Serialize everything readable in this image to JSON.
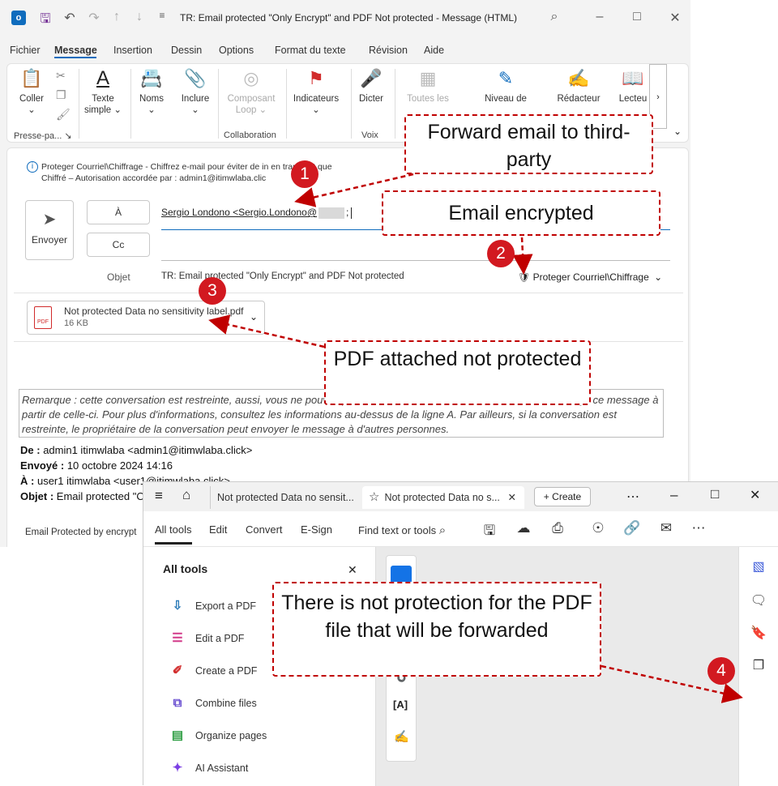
{
  "outlook": {
    "title": "TR: Email protected \"Only Encrypt\" and PDF Not protected  -  Message (HTML)",
    "menu": [
      "Fichier",
      "Message",
      "Insertion",
      "Dessin",
      "Options",
      "Format du texte",
      "Révision",
      "Aide"
    ],
    "ribbon": {
      "coller": "Coller",
      "texte": "Texte",
      "simple": "simple ⌄",
      "noms": "Noms",
      "inclure": "Inclure",
      "composant": "Composant",
      "loop": "Loop ⌄",
      "indicateurs": "Indicateurs",
      "dicter": "Dicter",
      "toutes": "Toutes les",
      "niveau": "Niveau de",
      "redacteur": "Rédacteur",
      "lecteur": "Lecteu",
      "grp_presse": "Presse-pa...",
      "grp_collab": "Collaboration",
      "grp_voix": "Voix"
    },
    "banner_line1": "Proteger Courriel\\Chiffrage - Chiffrez e-mail pour éviter de in",
    "banner_line1b": "en transit et que",
    "banner_line2": "Chiffré – Autorisation accordée par : admin1@itimwlaba.clic",
    "send_label": "Envoyer",
    "to_label": "À",
    "cc_label": "Cc",
    "to_value": "Sergio Londono <Sergio.Londono@",
    "to_suffix": ";",
    "subject_label": "Objet",
    "subject_value": "TR: Email protected \"Only Encrypt\" and PDF Not protected",
    "sensitivity_label": "Proteger Courriel\\Chiffrage",
    "attachment_name": "Not protected Data no sensitivity label.pdf",
    "attachment_size": "16 KB",
    "attachment_icon": "PDF",
    "note_text": "Remarque : cette conversation est restreinte, aussi, vous ne pouvez pas la transférer sans autorisation. Si vous avez reçu ce message à partir de celle-ci. Pour plus d'informations, consultez les informations au-dessus de la ligne A. Par ailleurs, si la conversation est restreinte, le propriétaire de la conversation peut envoyer le message à d'autres personnes.",
    "from_label": "De :",
    "from_value": "admin1 itimwlaba <admin1@itimwlaba.click>",
    "sent_label": "Envoyé :",
    "sent_value": "10 octobre 2024 14:16",
    "to2_label": "À :",
    "to2_value": "user1 itimwlaba <user1@itimwlaba.click>",
    "subj2_label": "Objet :",
    "subj2_value": "Email protected \"O",
    "body_text": "Email Protected by encrypt"
  },
  "acrobat": {
    "tab1": "Not protected Data no sensit...",
    "tab2": "Not protected Data no s...",
    "create": "Create",
    "toolbar": [
      "All tools",
      "Edit",
      "Convert",
      "E-Sign"
    ],
    "find": "Find text or tools",
    "panel_title": "All tools",
    "tools": [
      {
        "label": "Export a PDF",
        "icon": "export-pdf-icon",
        "color": "#2a7ab8"
      },
      {
        "label": "Edit a PDF",
        "icon": "edit-pdf-icon",
        "color": "#d23b8a"
      },
      {
        "label": "Create a PDF",
        "icon": "create-pdf-icon",
        "color": "#d22d2d"
      },
      {
        "label": "Combine files",
        "icon": "combine-files-icon",
        "color": "#6a4fd0"
      },
      {
        "label": "Organize pages",
        "icon": "organize-pages-icon",
        "color": "#2f9e44"
      },
      {
        "label": "AI Assistant",
        "icon": "ai-assistant-icon",
        "color": "#7b3fe4"
      }
    ]
  },
  "callouts": {
    "c1": "Forward email to third-party",
    "c2": "Email encrypted",
    "c3": "PDF attached not protected",
    "c4": "There is not protection for the PDF file that will be forwarded"
  },
  "badges": [
    "1",
    "2",
    "3",
    "4"
  ],
  "colors": {
    "accent_red": "#c00000",
    "badge_red": "#d21920",
    "outlook_blue": "#0f6cbd"
  }
}
